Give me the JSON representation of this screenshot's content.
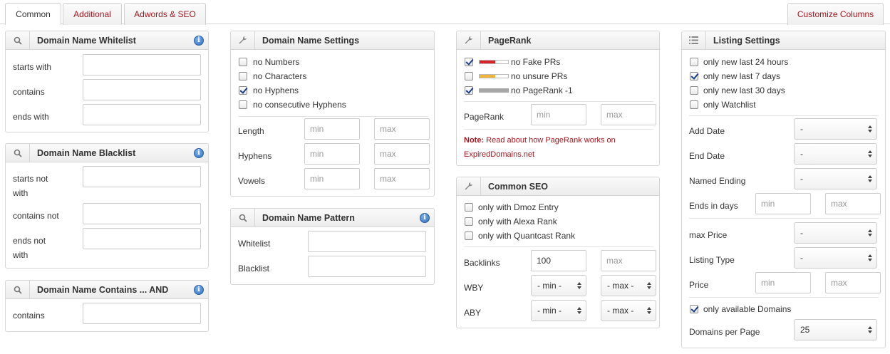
{
  "tabs": {
    "common": "Common",
    "additional": "Additional",
    "adwords": "Adwords & SEO",
    "customize": "Customize Columns"
  },
  "whitelist": {
    "title": "Domain Name Whitelist",
    "starts_with": "starts with",
    "contains": "contains",
    "ends_with": "ends with"
  },
  "blacklist": {
    "title": "Domain Name Blacklist",
    "starts_not_1": "starts not",
    "starts_not_2": "with",
    "contains_not": "contains not",
    "ends_not_1": "ends not",
    "ends_not_2": "with"
  },
  "contains_and": {
    "title": "Domain Name Contains ... AND",
    "contains": "contains"
  },
  "settings": {
    "title": "Domain Name Settings",
    "options": [
      {
        "label": "no Numbers",
        "checked": false
      },
      {
        "label": "no Characters",
        "checked": false
      },
      {
        "label": "no Hyphens",
        "checked": true
      },
      {
        "label": "no consecutive Hyphens",
        "checked": false
      }
    ],
    "length": "Length",
    "hyphens": "Hyphens",
    "vowels": "Vowels",
    "min_ph": "min",
    "max_ph": "max"
  },
  "pattern": {
    "title": "Domain Name Pattern",
    "whitelist": "Whitelist",
    "blacklist": "Blacklist"
  },
  "pagerank": {
    "title": "PageRank",
    "options": [
      {
        "label": "no Fake PRs",
        "checked": true,
        "bar_color": "#d8232a"
      },
      {
        "label": "no unsure PRs",
        "checked": false,
        "bar_color": "#f0b53a"
      },
      {
        "label": "no PageRank -1",
        "checked": true,
        "bar_color": "#a6a6a6"
      }
    ],
    "label": "PageRank",
    "min_ph": "min",
    "max_ph": "max",
    "note_bold": "Note:",
    "note_text": "Read about how PageRank works on",
    "note_text2": "ExpiredDomains.net"
  },
  "common_seo": {
    "title": "Common SEO",
    "options": [
      {
        "label": "only with Dmoz Entry",
        "checked": false
      },
      {
        "label": "only with Alexa Rank",
        "checked": false
      },
      {
        "label": "only with Quantcast Rank",
        "checked": false
      }
    ],
    "backlinks": "Backlinks",
    "backlinks_value": "100",
    "max_ph": "max",
    "wby": "WBY",
    "aby": "ABY",
    "min_sel": "- min -",
    "max_sel": "- max -"
  },
  "listing": {
    "title": "Listing Settings",
    "options": [
      {
        "label": "only new last 24 hours",
        "checked": false
      },
      {
        "label": "only new last 7 days",
        "checked": true
      },
      {
        "label": "only new last 30 days",
        "checked": false
      },
      {
        "label": "only Watchlist",
        "checked": false
      }
    ],
    "add_date": "Add Date",
    "end_date": "End Date",
    "named_ending": "Named Ending",
    "ends_in_days": "Ends in days",
    "max_price": "max Price",
    "listing_type": "Listing Type",
    "price": "Price",
    "dash": "-",
    "min_ph": "min",
    "max_ph": "max",
    "only_available": "only available Domains",
    "only_available_checked": true,
    "per_page": "Domains per Page",
    "per_page_value": "25"
  }
}
